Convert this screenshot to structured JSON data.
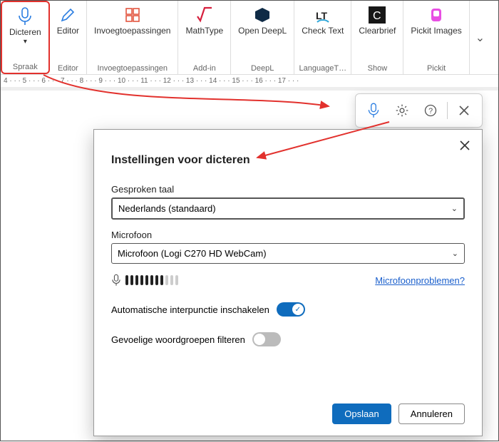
{
  "ribbon": {
    "groups": [
      {
        "label": "Spraak",
        "items": [
          {
            "label": "Dicteren"
          }
        ]
      },
      {
        "label": "Editor",
        "items": [
          {
            "label": "Editor"
          }
        ]
      },
      {
        "label": "Invoegtoepassingen",
        "items": [
          {
            "label": "Invoegtoepassingen"
          }
        ]
      },
      {
        "label": "Add-in",
        "items": [
          {
            "label": "MathType"
          }
        ]
      },
      {
        "label": "DeepL",
        "items": [
          {
            "label": "Open DeepL"
          }
        ]
      },
      {
        "label": "LanguageT…",
        "items": [
          {
            "label": "Check Text"
          }
        ]
      },
      {
        "label": "Show",
        "items": [
          {
            "label": "Clearbrief"
          }
        ]
      },
      {
        "label": "Pickit",
        "items": [
          {
            "label": "Pickit Images"
          }
        ]
      }
    ]
  },
  "ruler": {
    "marks": "4 · · · 5 · · · 6 · · · 7 · · · 8 · · · 9 · · · 10 · · · 11 · · · 12 · · · 13 · · · 14 · · · 15 · · · 16 · · · 17 · · ·"
  },
  "floatbar": {
    "mic_icon": "mic-icon",
    "settings_icon": "gear-icon",
    "help_icon": "help-icon",
    "close_icon": "close-icon"
  },
  "dialog": {
    "title": "Instellingen voor dicteren",
    "lang_label": "Gesproken taal",
    "lang_value": "Nederlands (standaard)",
    "mic_label": "Microfoon",
    "mic_value": "Microfoon (Logi C270 HD WebCam)",
    "mic_problems": "Microfoonproblemen?",
    "auto_punct": "Automatische interpunctie inschakelen",
    "sensitive_filter": "Gevoelige woordgroepen filteren",
    "save": "Opslaan",
    "cancel": "Annuleren"
  }
}
